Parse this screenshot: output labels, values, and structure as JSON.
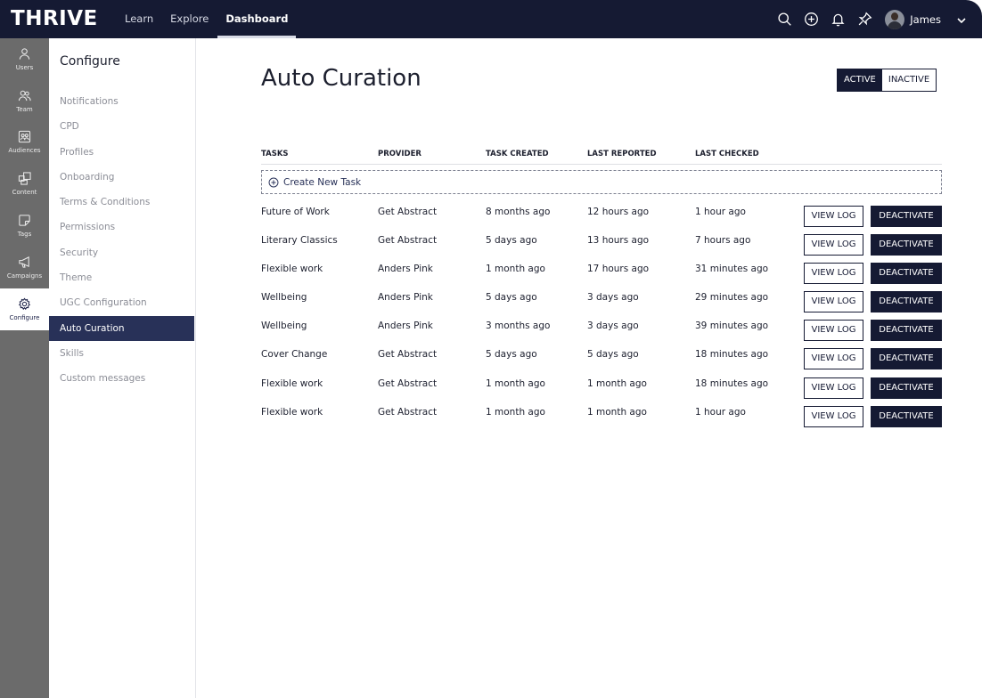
{
  "app": {
    "logo": "THRIVE"
  },
  "topnav": {
    "items": [
      {
        "label": "Learn",
        "active": false
      },
      {
        "label": "Explore",
        "active": false
      },
      {
        "label": "Dashboard",
        "active": true
      }
    ],
    "icons": [
      "search-icon",
      "add-circle-icon",
      "bell-icon",
      "pin-icon"
    ],
    "user": {
      "name": "James"
    }
  },
  "rail": {
    "items": [
      {
        "label": "Users",
        "icon": "user-icon"
      },
      {
        "label": "Team",
        "icon": "team-icon"
      },
      {
        "label": "Audiences",
        "icon": "audiences-icon"
      },
      {
        "label": "Content",
        "icon": "content-icon"
      },
      {
        "label": "Tags",
        "icon": "tag-icon"
      },
      {
        "label": "Campaigns",
        "icon": "megaphone-icon"
      },
      {
        "label": "Configure",
        "icon": "gear-icon",
        "active": true
      }
    ]
  },
  "subnav": {
    "title": "Configure",
    "items": [
      {
        "label": "Notifications"
      },
      {
        "label": "CPD"
      },
      {
        "label": "Profiles"
      },
      {
        "label": "Onboarding"
      },
      {
        "label": "Terms & Conditions"
      },
      {
        "label": "Permissions"
      },
      {
        "label": "Security"
      },
      {
        "label": "Theme"
      },
      {
        "label": "UGC Configuration"
      },
      {
        "label": "Auto Curation",
        "active": true
      },
      {
        "label": "Skills"
      },
      {
        "label": "Custom messages"
      }
    ]
  },
  "main": {
    "title": "Auto Curation",
    "toggle": {
      "active": "ACTIVE",
      "inactive": "INACTIVE"
    },
    "columns": [
      "TASKS",
      "PROVIDER",
      "TASK CREATED",
      "LAST REPORTED",
      "LAST CHECKED"
    ],
    "create_label": "Create New Task",
    "view_log_label": "VIEW LOG",
    "deactivate_label": "DEACTIVATE",
    "rows": [
      {
        "task": "Future of Work",
        "provider": "Get Abstract",
        "created": "8 months ago",
        "reported": "12 hours ago",
        "checked": "1 hour ago"
      },
      {
        "task": "Literary Classics",
        "provider": "Get Abstract",
        "created": "5 days ago",
        "reported": "13 hours ago",
        "checked": "7 hours ago"
      },
      {
        "task": "Flexible work",
        "provider": "Anders Pink",
        "created": "1 month ago",
        "reported": "17 hours ago",
        "checked": "31 minutes ago"
      },
      {
        "task": "Wellbeing",
        "provider": "Anders Pink",
        "created": "5 days ago",
        "reported": "3 days ago",
        "checked": "29 minutes ago"
      },
      {
        "task": "Wellbeing",
        "provider": "Anders Pink",
        "created": "3 months ago",
        "reported": "3 days ago",
        "checked": "39 minutes ago"
      },
      {
        "task": "Cover Change",
        "provider": "Get Abstract",
        "created": "5 days ago",
        "reported": "5 days ago",
        "checked": "18 minutes ago"
      },
      {
        "task": "Flexible work",
        "provider": "Get Abstract",
        "created": "1 month ago",
        "reported": "1 month ago",
        "checked": "18 minutes ago"
      },
      {
        "task": "Flexible work",
        "provider": "Get Abstract",
        "created": "1 month ago",
        "reported": "1 month ago",
        "checked": "1 hour ago"
      }
    ]
  },
  "colors": {
    "navy": "#151a33",
    "active_nav": "#283158",
    "rail": "#6b6b6b"
  }
}
